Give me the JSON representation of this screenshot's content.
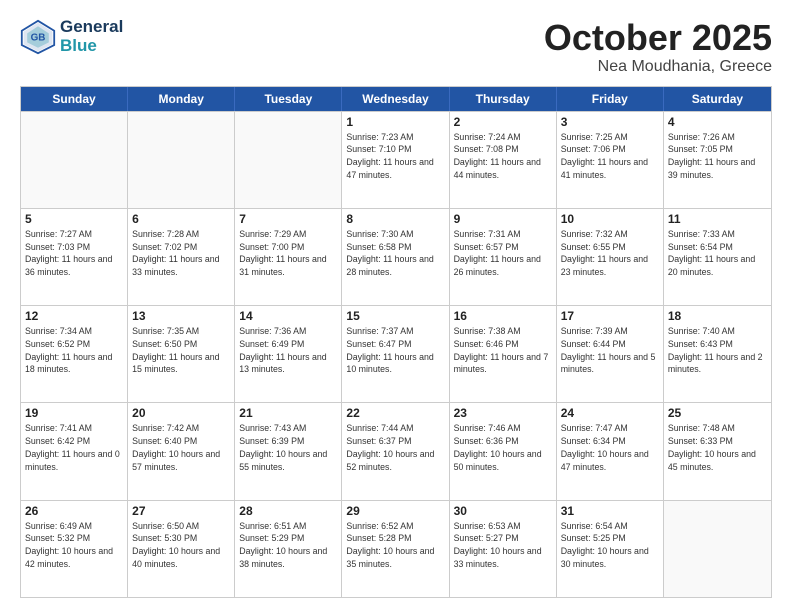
{
  "header": {
    "logo_line1": "General",
    "logo_line2": "Blue",
    "month": "October 2025",
    "location": "Nea Moudhania, Greece"
  },
  "days_of_week": [
    "Sunday",
    "Monday",
    "Tuesday",
    "Wednesday",
    "Thursday",
    "Friday",
    "Saturday"
  ],
  "rows": [
    [
      {
        "day": "",
        "info": ""
      },
      {
        "day": "",
        "info": ""
      },
      {
        "day": "",
        "info": ""
      },
      {
        "day": "1",
        "info": "Sunrise: 7:23 AM\nSunset: 7:10 PM\nDaylight: 11 hours and 47 minutes."
      },
      {
        "day": "2",
        "info": "Sunrise: 7:24 AM\nSunset: 7:08 PM\nDaylight: 11 hours and 44 minutes."
      },
      {
        "day": "3",
        "info": "Sunrise: 7:25 AM\nSunset: 7:06 PM\nDaylight: 11 hours and 41 minutes."
      },
      {
        "day": "4",
        "info": "Sunrise: 7:26 AM\nSunset: 7:05 PM\nDaylight: 11 hours and 39 minutes."
      }
    ],
    [
      {
        "day": "5",
        "info": "Sunrise: 7:27 AM\nSunset: 7:03 PM\nDaylight: 11 hours and 36 minutes."
      },
      {
        "day": "6",
        "info": "Sunrise: 7:28 AM\nSunset: 7:02 PM\nDaylight: 11 hours and 33 minutes."
      },
      {
        "day": "7",
        "info": "Sunrise: 7:29 AM\nSunset: 7:00 PM\nDaylight: 11 hours and 31 minutes."
      },
      {
        "day": "8",
        "info": "Sunrise: 7:30 AM\nSunset: 6:58 PM\nDaylight: 11 hours and 28 minutes."
      },
      {
        "day": "9",
        "info": "Sunrise: 7:31 AM\nSunset: 6:57 PM\nDaylight: 11 hours and 26 minutes."
      },
      {
        "day": "10",
        "info": "Sunrise: 7:32 AM\nSunset: 6:55 PM\nDaylight: 11 hours and 23 minutes."
      },
      {
        "day": "11",
        "info": "Sunrise: 7:33 AM\nSunset: 6:54 PM\nDaylight: 11 hours and 20 minutes."
      }
    ],
    [
      {
        "day": "12",
        "info": "Sunrise: 7:34 AM\nSunset: 6:52 PM\nDaylight: 11 hours and 18 minutes."
      },
      {
        "day": "13",
        "info": "Sunrise: 7:35 AM\nSunset: 6:50 PM\nDaylight: 11 hours and 15 minutes."
      },
      {
        "day": "14",
        "info": "Sunrise: 7:36 AM\nSunset: 6:49 PM\nDaylight: 11 hours and 13 minutes."
      },
      {
        "day": "15",
        "info": "Sunrise: 7:37 AM\nSunset: 6:47 PM\nDaylight: 11 hours and 10 minutes."
      },
      {
        "day": "16",
        "info": "Sunrise: 7:38 AM\nSunset: 6:46 PM\nDaylight: 11 hours and 7 minutes."
      },
      {
        "day": "17",
        "info": "Sunrise: 7:39 AM\nSunset: 6:44 PM\nDaylight: 11 hours and 5 minutes."
      },
      {
        "day": "18",
        "info": "Sunrise: 7:40 AM\nSunset: 6:43 PM\nDaylight: 11 hours and 2 minutes."
      }
    ],
    [
      {
        "day": "19",
        "info": "Sunrise: 7:41 AM\nSunset: 6:42 PM\nDaylight: 11 hours and 0 minutes."
      },
      {
        "day": "20",
        "info": "Sunrise: 7:42 AM\nSunset: 6:40 PM\nDaylight: 10 hours and 57 minutes."
      },
      {
        "day": "21",
        "info": "Sunrise: 7:43 AM\nSunset: 6:39 PM\nDaylight: 10 hours and 55 minutes."
      },
      {
        "day": "22",
        "info": "Sunrise: 7:44 AM\nSunset: 6:37 PM\nDaylight: 10 hours and 52 minutes."
      },
      {
        "day": "23",
        "info": "Sunrise: 7:46 AM\nSunset: 6:36 PM\nDaylight: 10 hours and 50 minutes."
      },
      {
        "day": "24",
        "info": "Sunrise: 7:47 AM\nSunset: 6:34 PM\nDaylight: 10 hours and 47 minutes."
      },
      {
        "day": "25",
        "info": "Sunrise: 7:48 AM\nSunset: 6:33 PM\nDaylight: 10 hours and 45 minutes."
      }
    ],
    [
      {
        "day": "26",
        "info": "Sunrise: 6:49 AM\nSunset: 5:32 PM\nDaylight: 10 hours and 42 minutes."
      },
      {
        "day": "27",
        "info": "Sunrise: 6:50 AM\nSunset: 5:30 PM\nDaylight: 10 hours and 40 minutes."
      },
      {
        "day": "28",
        "info": "Sunrise: 6:51 AM\nSunset: 5:29 PM\nDaylight: 10 hours and 38 minutes."
      },
      {
        "day": "29",
        "info": "Sunrise: 6:52 AM\nSunset: 5:28 PM\nDaylight: 10 hours and 35 minutes."
      },
      {
        "day": "30",
        "info": "Sunrise: 6:53 AM\nSunset: 5:27 PM\nDaylight: 10 hours and 33 minutes."
      },
      {
        "day": "31",
        "info": "Sunrise: 6:54 AM\nSunset: 5:25 PM\nDaylight: 10 hours and 30 minutes."
      },
      {
        "day": "",
        "info": ""
      }
    ]
  ]
}
